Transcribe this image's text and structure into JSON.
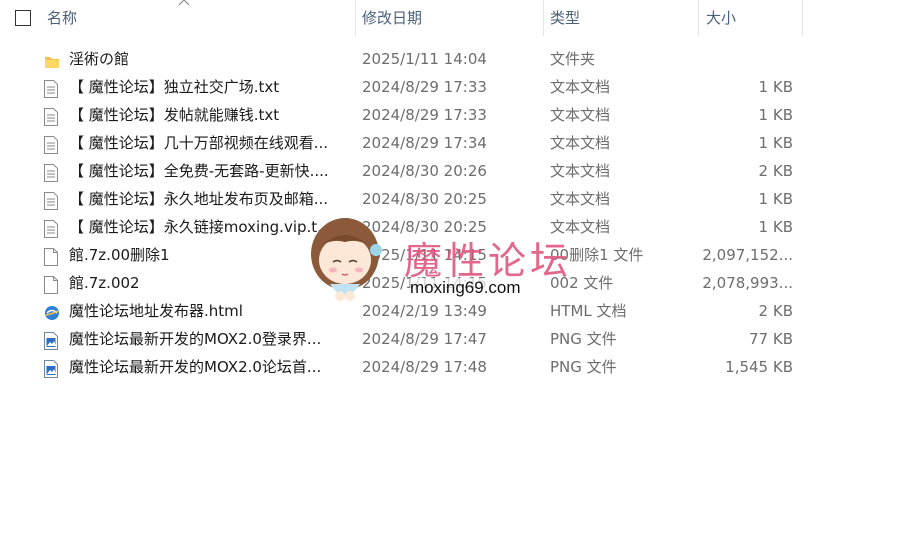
{
  "columns": {
    "name": "名称",
    "date": "修改日期",
    "type": "类型",
    "size": "大小"
  },
  "files": [
    {
      "icon": "folder-icon",
      "name": "淫術の館",
      "date": "2025/1/11 14:04",
      "type": "文件夹",
      "size": ""
    },
    {
      "icon": "text-file-icon",
      "name": "【 魔性论坛】独立社交广场.txt",
      "date": "2024/8/29 17:33",
      "type": "文本文档",
      "size": "1 KB"
    },
    {
      "icon": "text-file-icon",
      "name": "【 魔性论坛】发帖就能赚钱.txt",
      "date": "2024/8/29 17:33",
      "type": "文本文档",
      "size": "1 KB"
    },
    {
      "icon": "text-file-icon",
      "name": "【 魔性论坛】几十万部视频在线观看...",
      "date": "2024/8/29 17:34",
      "type": "文本文档",
      "size": "1 KB"
    },
    {
      "icon": "text-file-icon",
      "name": "【 魔性论坛】全免费-无套路-更新快....",
      "date": "2024/8/30 20:26",
      "type": "文本文档",
      "size": "2 KB"
    },
    {
      "icon": "text-file-icon",
      "name": "【 魔性论坛】永久地址发布页及邮箱...",
      "date": "2024/8/30 20:25",
      "type": "文本文档",
      "size": "1 KB"
    },
    {
      "icon": "text-file-icon",
      "name": "【 魔性论坛】永久链接moxing.vip.t...",
      "date": "2024/8/30 20:25",
      "type": "文本文档",
      "size": "1 KB"
    },
    {
      "icon": "blank-file-icon",
      "name": "館.7z.00删除1",
      "date": "2025/1/11 14:15",
      "type": "00删除1 文件",
      "size": "2,097,152..."
    },
    {
      "icon": "blank-file-icon",
      "name": "館.7z.002",
      "date": "2025/1/11 14:15",
      "type": "002 文件",
      "size": "2,078,993..."
    },
    {
      "icon": "html-file-icon",
      "name": "魔性论坛地址发布器.html",
      "date": "2024/2/19 13:49",
      "type": "HTML 文档",
      "size": "2 KB"
    },
    {
      "icon": "png-file-icon",
      "name": "魔性论坛最新开发的MOX2.0登录界...",
      "date": "2024/8/29 17:47",
      "type": "PNG 文件",
      "size": "77 KB"
    },
    {
      "icon": "png-file-icon",
      "name": "魔性论坛最新开发的MOX2.0论坛首...",
      "date": "2024/8/29 17:48",
      "type": "PNG 文件",
      "size": "1,545 KB"
    }
  ],
  "watermark": {
    "title": "魔性论坛",
    "url": "moxing69.com"
  }
}
